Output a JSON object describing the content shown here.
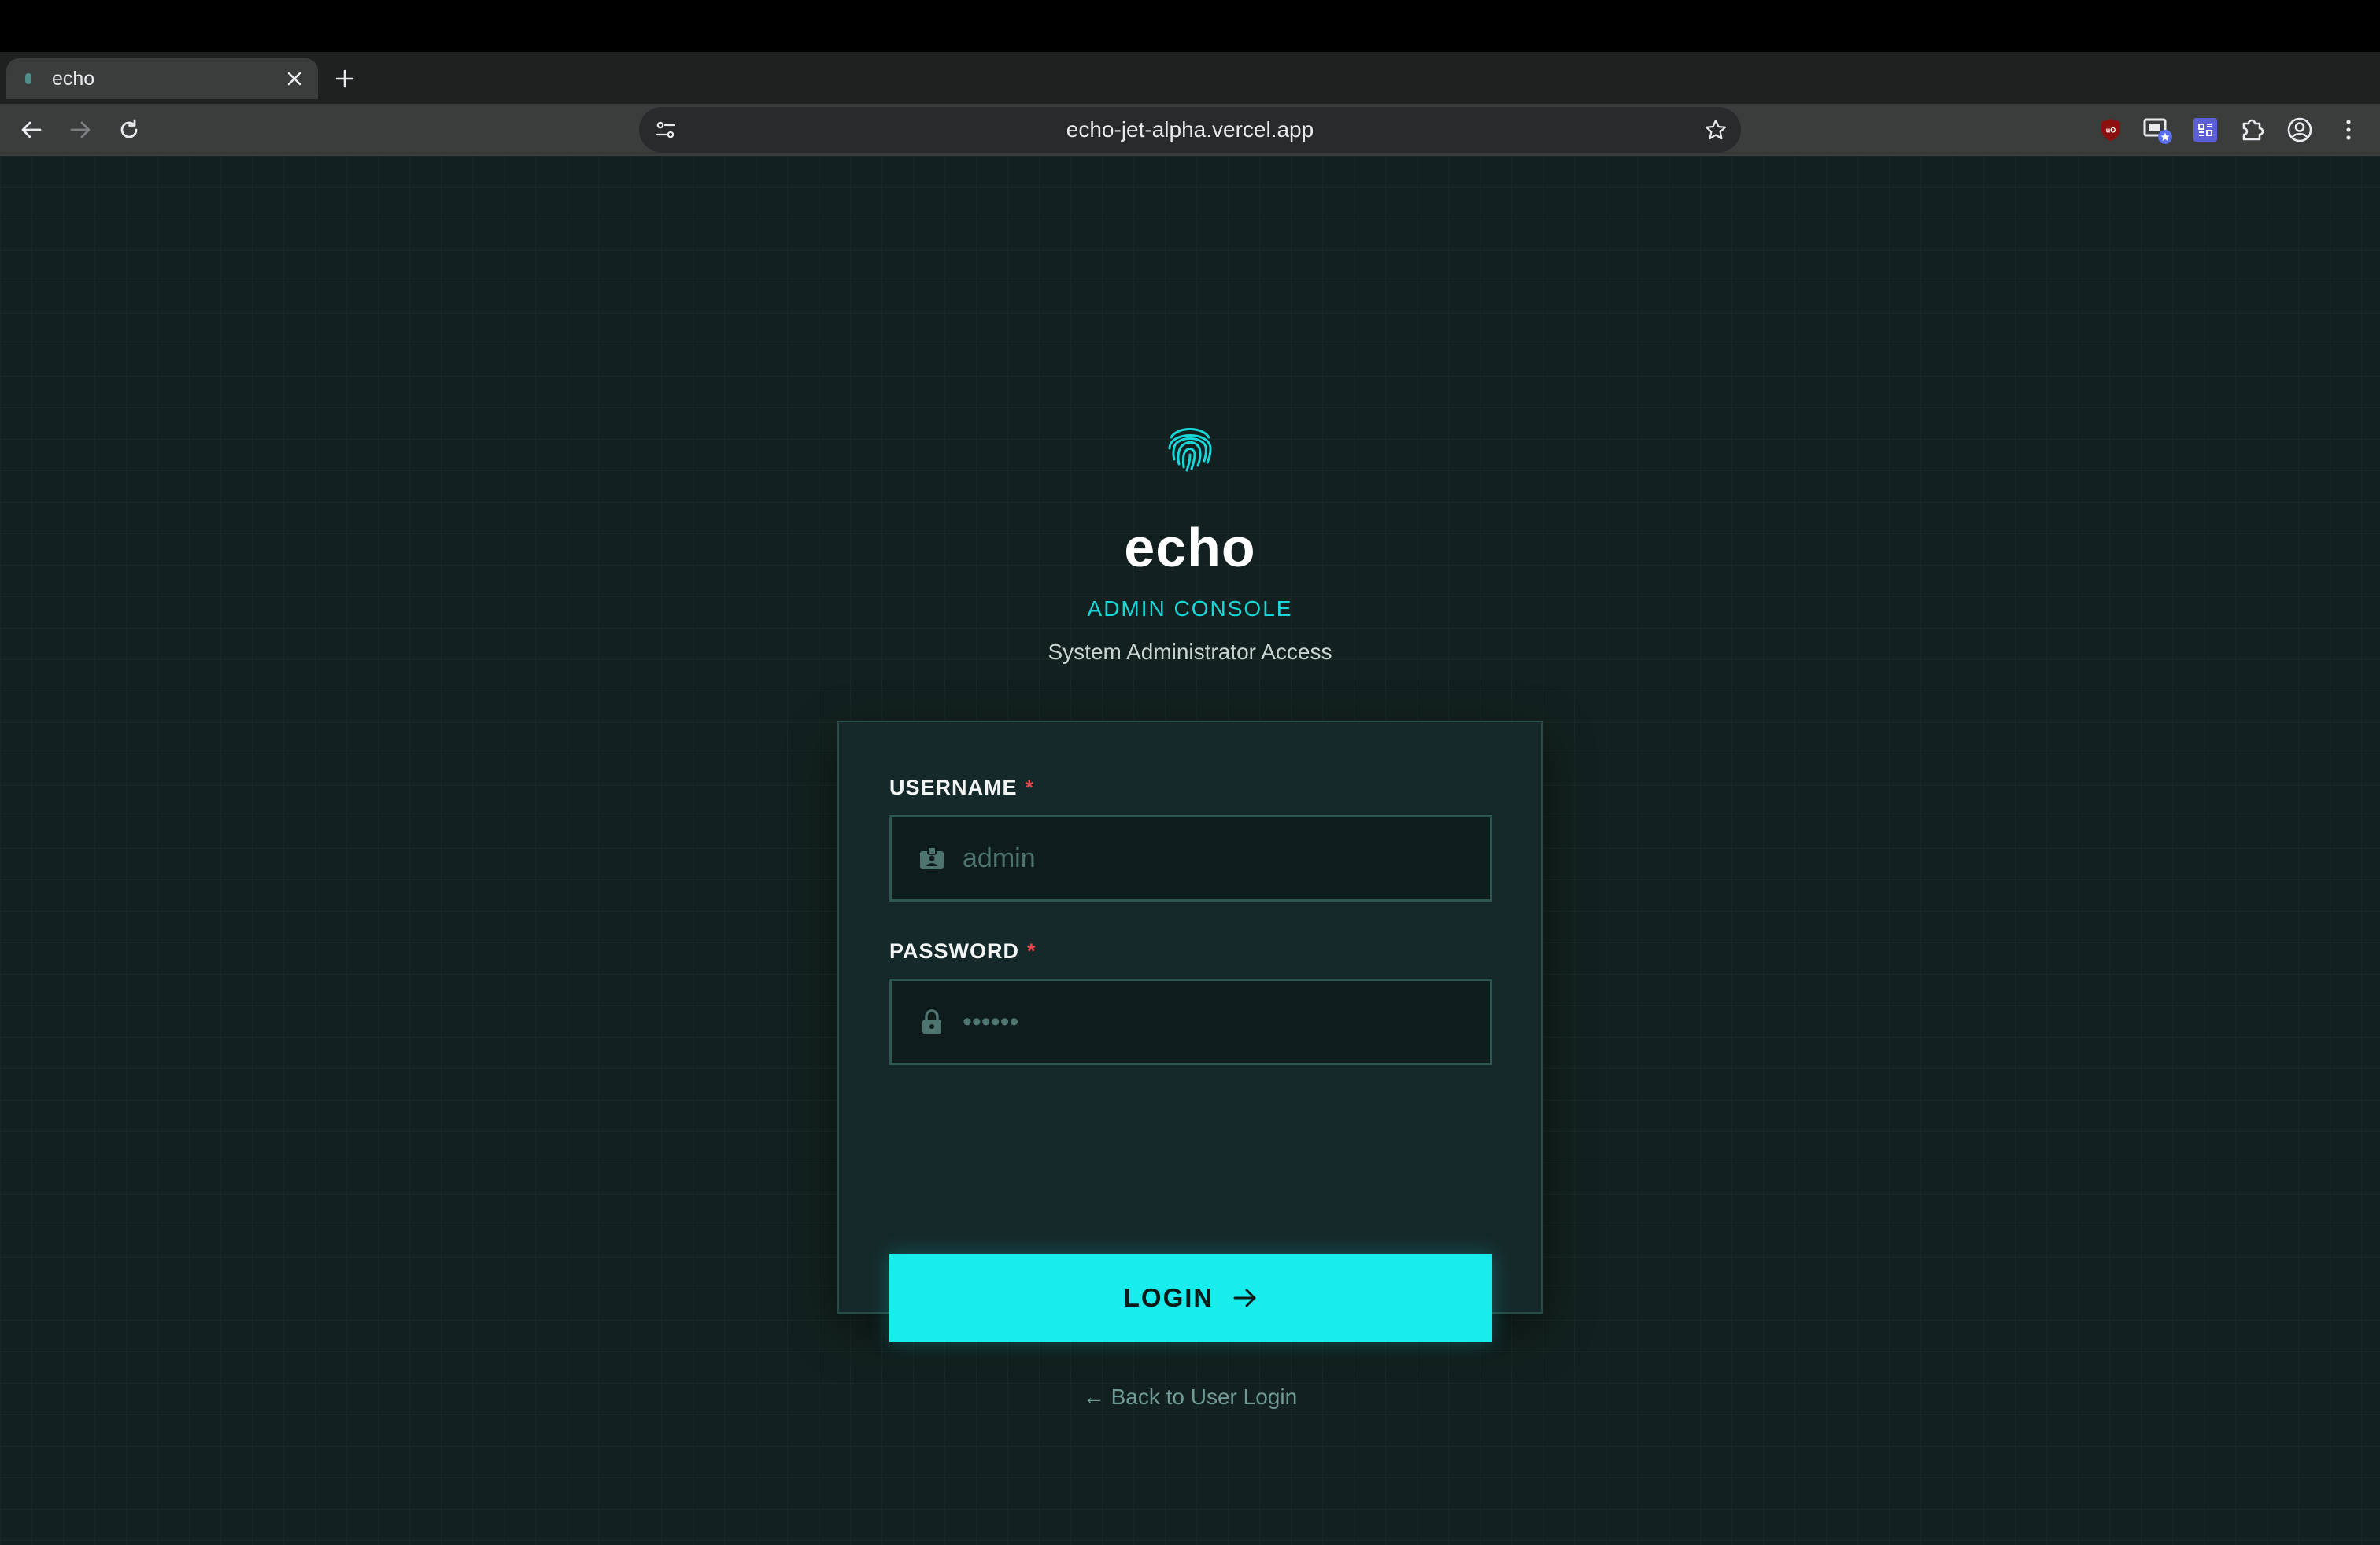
{
  "browser": {
    "tab": {
      "title": "echo",
      "favicon": "echo-favicon-icon"
    },
    "url": "echo-jet-alpha.vercel.app",
    "icons": [
      "back-icon",
      "forward-icon",
      "reload-icon",
      "site-info-icon",
      "bookmark-star-icon",
      "ublock-extension-icon",
      "picture-in-picture-extension-icon",
      "extension-icon",
      "extensions-puzzle-icon",
      "profile-icon",
      "menu-icon"
    ]
  },
  "app": {
    "logo": "fingerprint-icon",
    "name": "echo",
    "console_label": "ADMIN CONSOLE",
    "subtitle": "System Administrator Access"
  },
  "form": {
    "username_label": "USERNAME",
    "username_placeholder": "admin",
    "password_label": "PASSWORD",
    "password_placeholder": "••••••",
    "required_marker": "*",
    "login_label": "LOGIN",
    "back_link": "← Back to User Login"
  },
  "colors": {
    "accent": "#18ecec",
    "background": "#12211f",
    "card": "#15292a",
    "required": "#e0484e"
  }
}
